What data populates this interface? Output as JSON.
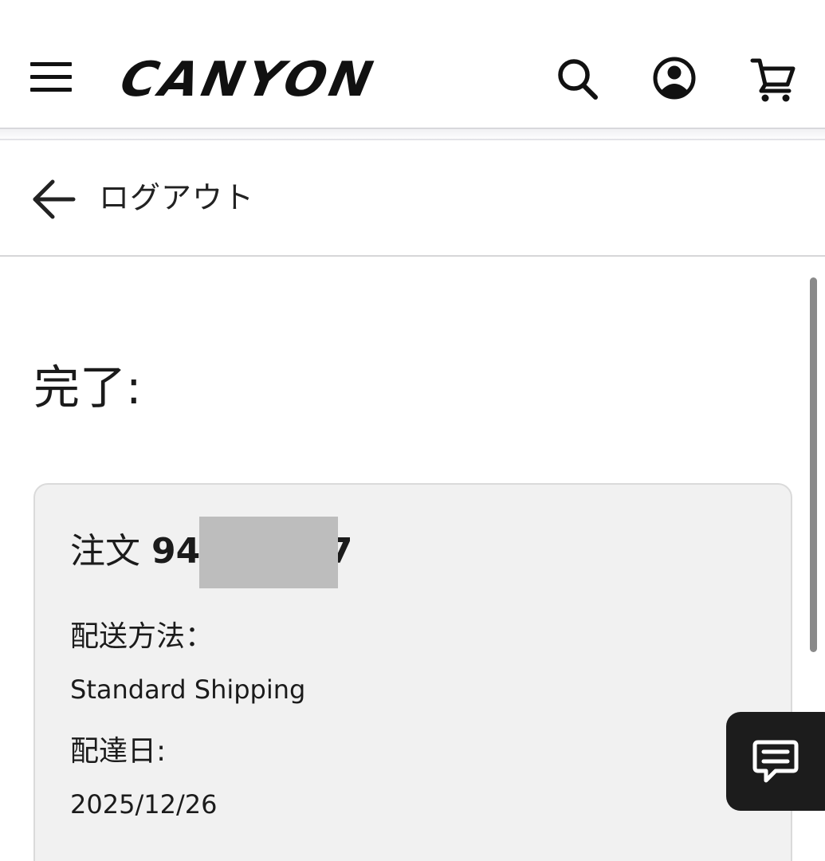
{
  "header": {
    "logo_text": "CANYON",
    "icons": [
      "menu-icon",
      "search-icon",
      "account-icon",
      "cart-icon"
    ]
  },
  "logout": {
    "label": "ログアウト",
    "icon": "arrow-left-icon"
  },
  "main": {
    "title": "完了:",
    "order": {
      "prefix": "注文",
      "number_visible_start": "94",
      "number_visible_end": "37",
      "shipping_method_label": "配送方法：",
      "shipping_method_value": "Standard Shipping",
      "delivery_date_label": "配達日:",
      "delivery_date_value": "2025/12/26"
    }
  },
  "chat": {
    "icon": "chat-icon"
  },
  "colors": {
    "text": "#1b1b1b",
    "card_bg": "#f1f1f1",
    "card_border": "#dadada",
    "chat_bg": "#1c1c1c",
    "redaction": "#bdbdbd"
  }
}
